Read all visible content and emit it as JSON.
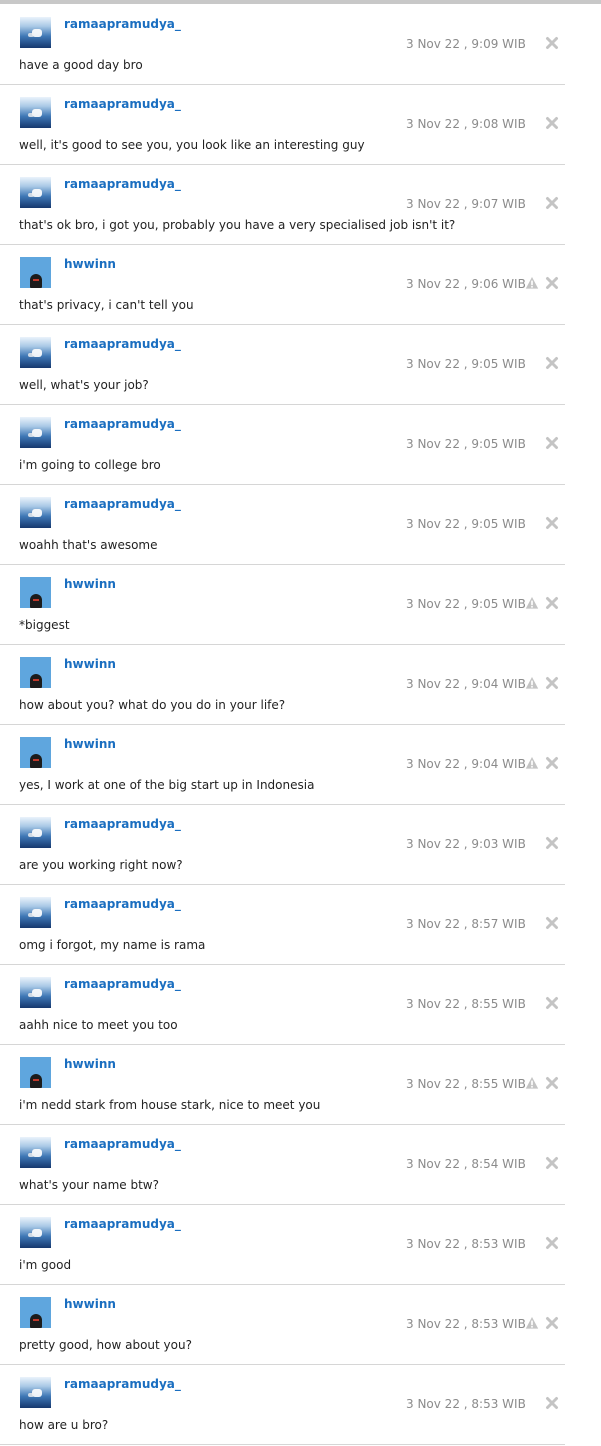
{
  "messages": [
    {
      "user": "ramaapramudya_",
      "avatar": "blue-sky-avatar",
      "time": "3 Nov 22 , 9:09 WIB",
      "text": "have a good day bro",
      "has_report": false
    },
    {
      "user": "ramaapramudya_",
      "avatar": "blue-sky-avatar",
      "time": "3 Nov 22 , 9:08 WIB",
      "text": "well, it's good to see you, you look like an interesting guy",
      "has_report": false
    },
    {
      "user": "ramaapramudya_",
      "avatar": "blue-sky-avatar",
      "time": "3 Nov 22 , 9:07 WIB",
      "text": "that's ok bro, i got you, probably you have a very specialised job isn't it?",
      "has_report": false
    },
    {
      "user": "hwwinn",
      "avatar": "teal-person-avatar",
      "time": "3 Nov 22 , 9:06 WIB",
      "text": "that's privacy, i can't tell you",
      "has_report": true
    },
    {
      "user": "ramaapramudya_",
      "avatar": "blue-sky-avatar",
      "time": "3 Nov 22 , 9:05 WIB",
      "text": "well, what's your job?",
      "has_report": false
    },
    {
      "user": "ramaapramudya_",
      "avatar": "blue-sky-avatar",
      "time": "3 Nov 22 , 9:05 WIB",
      "text": "i'm going to college bro",
      "has_report": false
    },
    {
      "user": "ramaapramudya_",
      "avatar": "blue-sky-avatar",
      "time": "3 Nov 22 , 9:05 WIB",
      "text": "woahh that's awesome",
      "has_report": false
    },
    {
      "user": "hwwinn",
      "avatar": "teal-person-avatar",
      "time": "3 Nov 22 , 9:05 WIB",
      "text": "*biggest",
      "has_report": true
    },
    {
      "user": "hwwinn",
      "avatar": "teal-person-avatar",
      "time": "3 Nov 22 , 9:04 WIB",
      "text": "how about you? what do you do in your life?",
      "has_report": true
    },
    {
      "user": "hwwinn",
      "avatar": "teal-person-avatar",
      "time": "3 Nov 22 , 9:04 WIB",
      "text": "yes, I work at one of the big start up in Indonesia",
      "has_report": true
    },
    {
      "user": "ramaapramudya_",
      "avatar": "blue-sky-avatar",
      "time": "3 Nov 22 , 9:03 WIB",
      "text": "are you working right now?",
      "has_report": false
    },
    {
      "user": "ramaapramudya_",
      "avatar": "blue-sky-avatar",
      "time": "3 Nov 22 , 8:57 WIB",
      "text": "omg i forgot, my name is rama",
      "has_report": false
    },
    {
      "user": "ramaapramudya_",
      "avatar": "blue-sky-avatar",
      "time": "3 Nov 22 , 8:55 WIB",
      "text": "aahh nice to meet you too",
      "has_report": false
    },
    {
      "user": "hwwinn",
      "avatar": "teal-person-avatar",
      "time": "3 Nov 22 , 8:55 WIB",
      "text": "i'm nedd stark from house stark, nice to meet you",
      "has_report": true
    },
    {
      "user": "ramaapramudya_",
      "avatar": "blue-sky-avatar",
      "time": "3 Nov 22 , 8:54 WIB",
      "text": "what's your name btw?",
      "has_report": false
    },
    {
      "user": "ramaapramudya_",
      "avatar": "blue-sky-avatar",
      "time": "3 Nov 22 , 8:53 WIB",
      "text": "i'm good",
      "has_report": false
    },
    {
      "user": "hwwinn",
      "avatar": "teal-person-avatar",
      "time": "3 Nov 22 , 8:53 WIB",
      "text": "pretty good, how about you?",
      "has_report": true
    },
    {
      "user": "ramaapramudya_",
      "avatar": "blue-sky-avatar",
      "time": "3 Nov 22 , 8:53 WIB",
      "text": "how are u bro?",
      "has_report": false
    }
  ],
  "colors": {
    "username": "#1a6ec0",
    "timestamp": "#8b8b8b",
    "message_text": "#222222",
    "divider": "#d6d6d6",
    "icon_gray": "#c4c4c4"
  }
}
